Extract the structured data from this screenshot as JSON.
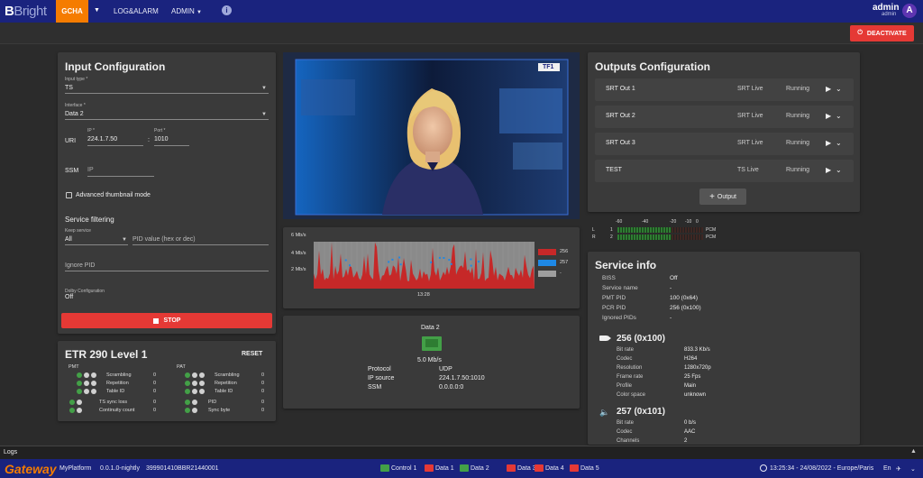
{
  "topbar": {
    "logo_a": "B",
    "logo_b": "Bright",
    "tab_active": "GCHA",
    "menu_log": "LOG&ALARM",
    "menu_admin": "ADMIN",
    "user_name": "admin",
    "user_role": "admin",
    "avatar": "A"
  },
  "deactivate_label": "DEACTIVATE",
  "input_config": {
    "title": "Input Configuration",
    "input_type_label": "Input type *",
    "input_type": "TS",
    "interface_label": "Interface *",
    "interface": "Data 2",
    "uri_label": "URI",
    "ip_label": "IP *",
    "ip": "224.1.7.50",
    "port_label": "Port *",
    "port": "1010",
    "colon": ":",
    "ssm_label": "SSM",
    "ssm_placeholder": "IP",
    "adv_thumb": "Advanced thumbnail mode",
    "service_filtering": "Service filtering",
    "keep_service_label": "Keep service",
    "keep_service": "All",
    "pid_placeholder": "PID value (hex or dec)",
    "ignore_pid": "Ignore PID",
    "dolby_label": "Dolby Configuration",
    "dolby_val": "Off",
    "stop": "STOP"
  },
  "etr": {
    "title": "ETR 290 Level 1",
    "reset": "RESET",
    "pmt": "PMT",
    "pat": "PAT",
    "left_rows": [
      {
        "label": "Scrambling",
        "count": "0"
      },
      {
        "label": "Repetition",
        "count": "0"
      },
      {
        "label": "Table ID",
        "count": "0"
      }
    ],
    "left_rows2": [
      {
        "label": "TS sync loss",
        "count": "0"
      },
      {
        "label": "Continuity count",
        "count": "0"
      }
    ],
    "right_rows": [
      {
        "label": "Scrambling",
        "count": "0"
      },
      {
        "label": "Repetition",
        "count": "0"
      },
      {
        "label": "Table ID",
        "count": "0"
      }
    ],
    "right_rows2": [
      {
        "label": "PID",
        "count": "0"
      },
      {
        "label": "Sync byte",
        "count": "0"
      }
    ]
  },
  "preview": {
    "channel_logo": "TF1"
  },
  "chart_data": {
    "type": "area",
    "ylabels": [
      "6 Mb/s",
      "4 Mb/s",
      "2 Mb/s"
    ],
    "ylim": [
      0,
      7
    ],
    "xlabel_time": "13:28",
    "series": [
      {
        "name": "256",
        "color": "#c62828"
      },
      {
        "name": "257",
        "color": "#1e88e5"
      },
      {
        "name": "-",
        "color": "#9e9e9e"
      }
    ]
  },
  "input_status": {
    "name": "Data 2",
    "bitrate": "5.0 Mb/s",
    "rows": [
      {
        "label": "Protocol",
        "value": "UDP"
      },
      {
        "label": "IP source",
        "value": "224.1.7.50:1010"
      },
      {
        "label": "SSM",
        "value": "0.0.0.0:0"
      }
    ]
  },
  "outputs": {
    "title": "Outputs Configuration",
    "rows": [
      {
        "name": "SRT Out 1",
        "type": "SRT Live",
        "status": "Running"
      },
      {
        "name": "SRT Out 2",
        "type": "SRT Live",
        "status": "Running"
      },
      {
        "name": "SRT Out 3",
        "type": "SRT Live",
        "status": "Running"
      },
      {
        "name": "TEST",
        "type": "TS Live",
        "status": "Running"
      }
    ],
    "add": "Output"
  },
  "meter": {
    "ticks": [
      "-60",
      "-40",
      "-20",
      "-10",
      "0"
    ],
    "ch_l": "L",
    "ch_r": "R",
    "n1": "1",
    "n2": "2",
    "pcm": "PCM"
  },
  "service_info": {
    "title": "Service info",
    "rows": [
      {
        "label": "BISS",
        "value": "Off"
      },
      {
        "label": "Service name",
        "value": "-"
      },
      {
        "label": "PMT PID",
        "value": "100 (0x64)"
      },
      {
        "label": "PCR PID",
        "value": "256 (0x100)"
      },
      {
        "label": "Ignored PIDs",
        "value": "-"
      }
    ],
    "video_title": "256 (0x100)",
    "video": [
      {
        "label": "Bit rate",
        "value": "833.3 Kb/s"
      },
      {
        "label": "Codec",
        "value": "H264"
      },
      {
        "label": "Resolution",
        "value": "1280x720p"
      },
      {
        "label": "Frame rate",
        "value": "25 Fps"
      },
      {
        "label": "Profile",
        "value": "Main"
      },
      {
        "label": "Color space",
        "value": "unknown"
      }
    ],
    "audio_title": "257 (0x101)",
    "audio": [
      {
        "label": "Bit rate",
        "value": "0 b/s"
      },
      {
        "label": "Codec",
        "value": "AAC"
      },
      {
        "label": "Channels",
        "value": "2"
      }
    ]
  },
  "logs_label": "Logs",
  "bottom": {
    "brand": "Gateway",
    "platform": "MyPlatform",
    "version": "0.0.1.0-nightly",
    "serial": "399901410BBR21440001",
    "statuses": [
      {
        "label": "Control 1",
        "color": "#43a047"
      },
      {
        "label": "Data 1",
        "color": "#e53935"
      },
      {
        "label": "Data 2",
        "color": "#43a047"
      },
      {
        "label": "Data 3",
        "color": "#e53935"
      },
      {
        "label": "Data 4",
        "color": "#e53935"
      },
      {
        "label": "Data 5",
        "color": "#e53935"
      }
    ],
    "clock": "13:25:34 - 24/08/2022 - Europe/Paris",
    "lang": "En"
  }
}
